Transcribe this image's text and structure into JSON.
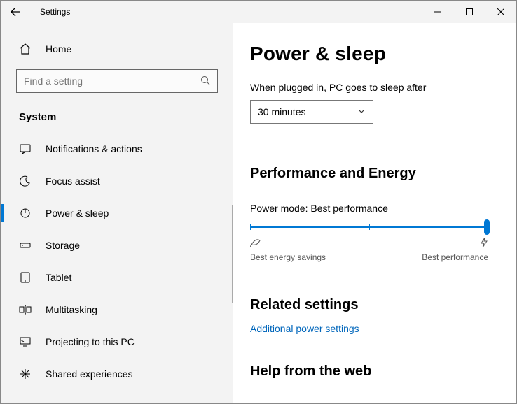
{
  "window": {
    "title": "Settings"
  },
  "sidebar": {
    "home": "Home",
    "search_placeholder": "Find a setting",
    "category": "System",
    "items": [
      {
        "label": "Notifications & actions"
      },
      {
        "label": "Focus assist"
      },
      {
        "label": "Power & sleep"
      },
      {
        "label": "Storage"
      },
      {
        "label": "Tablet"
      },
      {
        "label": "Multitasking"
      },
      {
        "label": "Projecting to this PC"
      },
      {
        "label": "Shared experiences"
      }
    ]
  },
  "main": {
    "title": "Power & sleep",
    "sleep_label": "When plugged in, PC goes to sleep after",
    "sleep_value": "30 minutes",
    "perf_heading": "Performance and Energy",
    "power_mode_label": "Power mode: Best performance",
    "slider_min_label": "Best energy savings",
    "slider_max_label": "Best performance",
    "related_heading": "Related settings",
    "related_link": "Additional power settings",
    "help_heading": "Help from the web"
  }
}
